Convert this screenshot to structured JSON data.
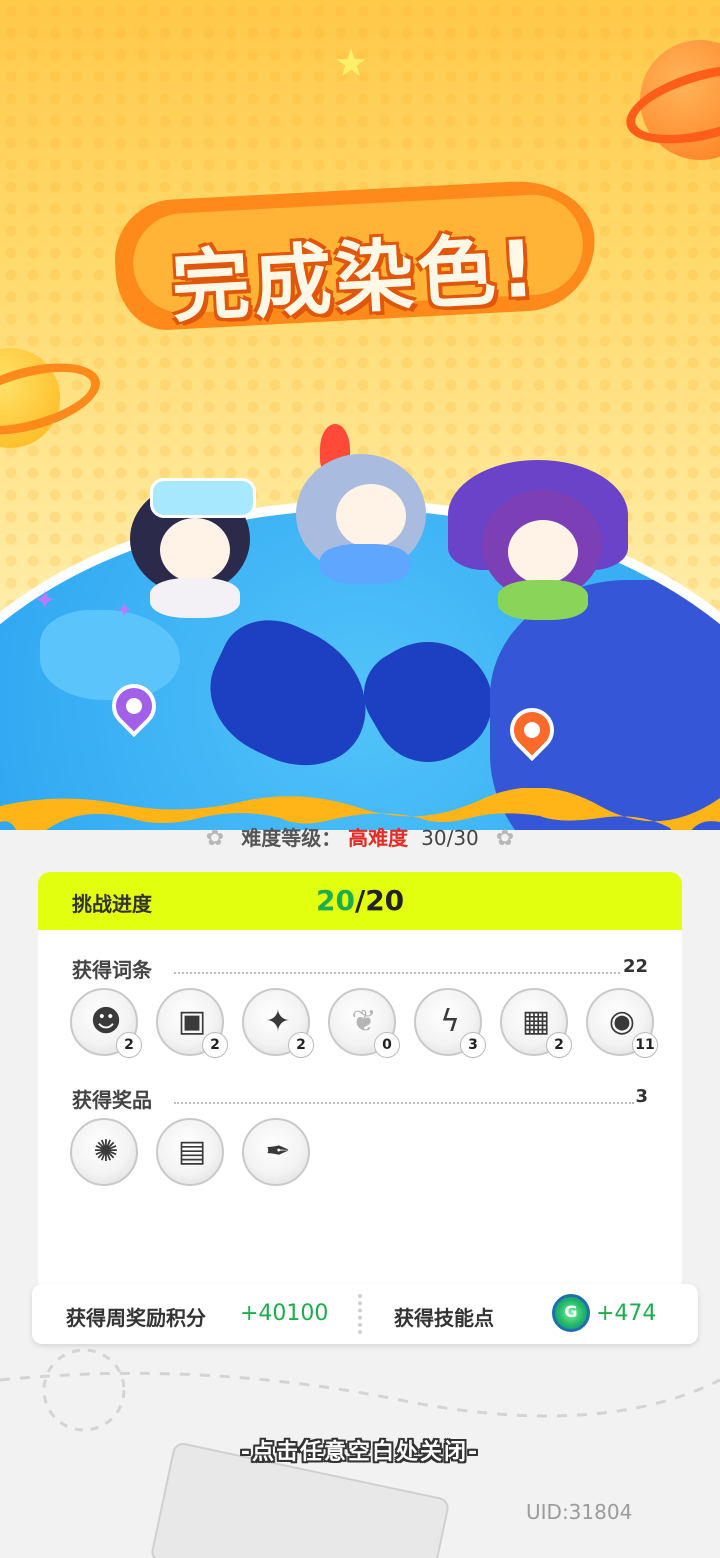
{
  "banner": {
    "title": "完成染色!"
  },
  "difficulty": {
    "label": "难度等级：",
    "level": "高难度",
    "count": "30/30"
  },
  "challenge": {
    "label": "挑战进度",
    "done": "20",
    "total": "/20"
  },
  "affixes": {
    "label": "获得词条",
    "total": "22",
    "items": [
      {
        "icon": "bomb-face-icon",
        "glyph": "☻",
        "count": "2"
      },
      {
        "icon": "card-icon",
        "glyph": "▣",
        "count": "2"
      },
      {
        "icon": "star-card-icon",
        "glyph": "✦",
        "count": "2"
      },
      {
        "icon": "sprout-icon",
        "glyph": "❦",
        "count": "0"
      },
      {
        "icon": "lightning-icon",
        "glyph": "ϟ",
        "count": "3"
      },
      {
        "icon": "film-icon",
        "glyph": "▦",
        "count": "2"
      },
      {
        "icon": "ball-icon",
        "glyph": "◉",
        "count": "11"
      }
    ]
  },
  "prizes": {
    "label": "获得奖品",
    "total": "3",
    "items": [
      {
        "icon": "moth-icon",
        "glyph": "✺"
      },
      {
        "icon": "gameboy-icon",
        "glyph": "▤"
      },
      {
        "icon": "fountain-pen-icon",
        "glyph": "✒"
      }
    ]
  },
  "rewards": {
    "weekly_label": "获得周奖励积分",
    "weekly_value": "+40100",
    "skill_label": "获得技能点",
    "skill_value": "+474"
  },
  "close_hint": "-点击任意空白处关闭-",
  "uid": "UID:31804",
  "colors": {
    "accent_green": "#1cae4d",
    "hard_red": "#e52b24",
    "progress_bar": "#e2ff10",
    "title_orange": "#ff8a1c"
  }
}
